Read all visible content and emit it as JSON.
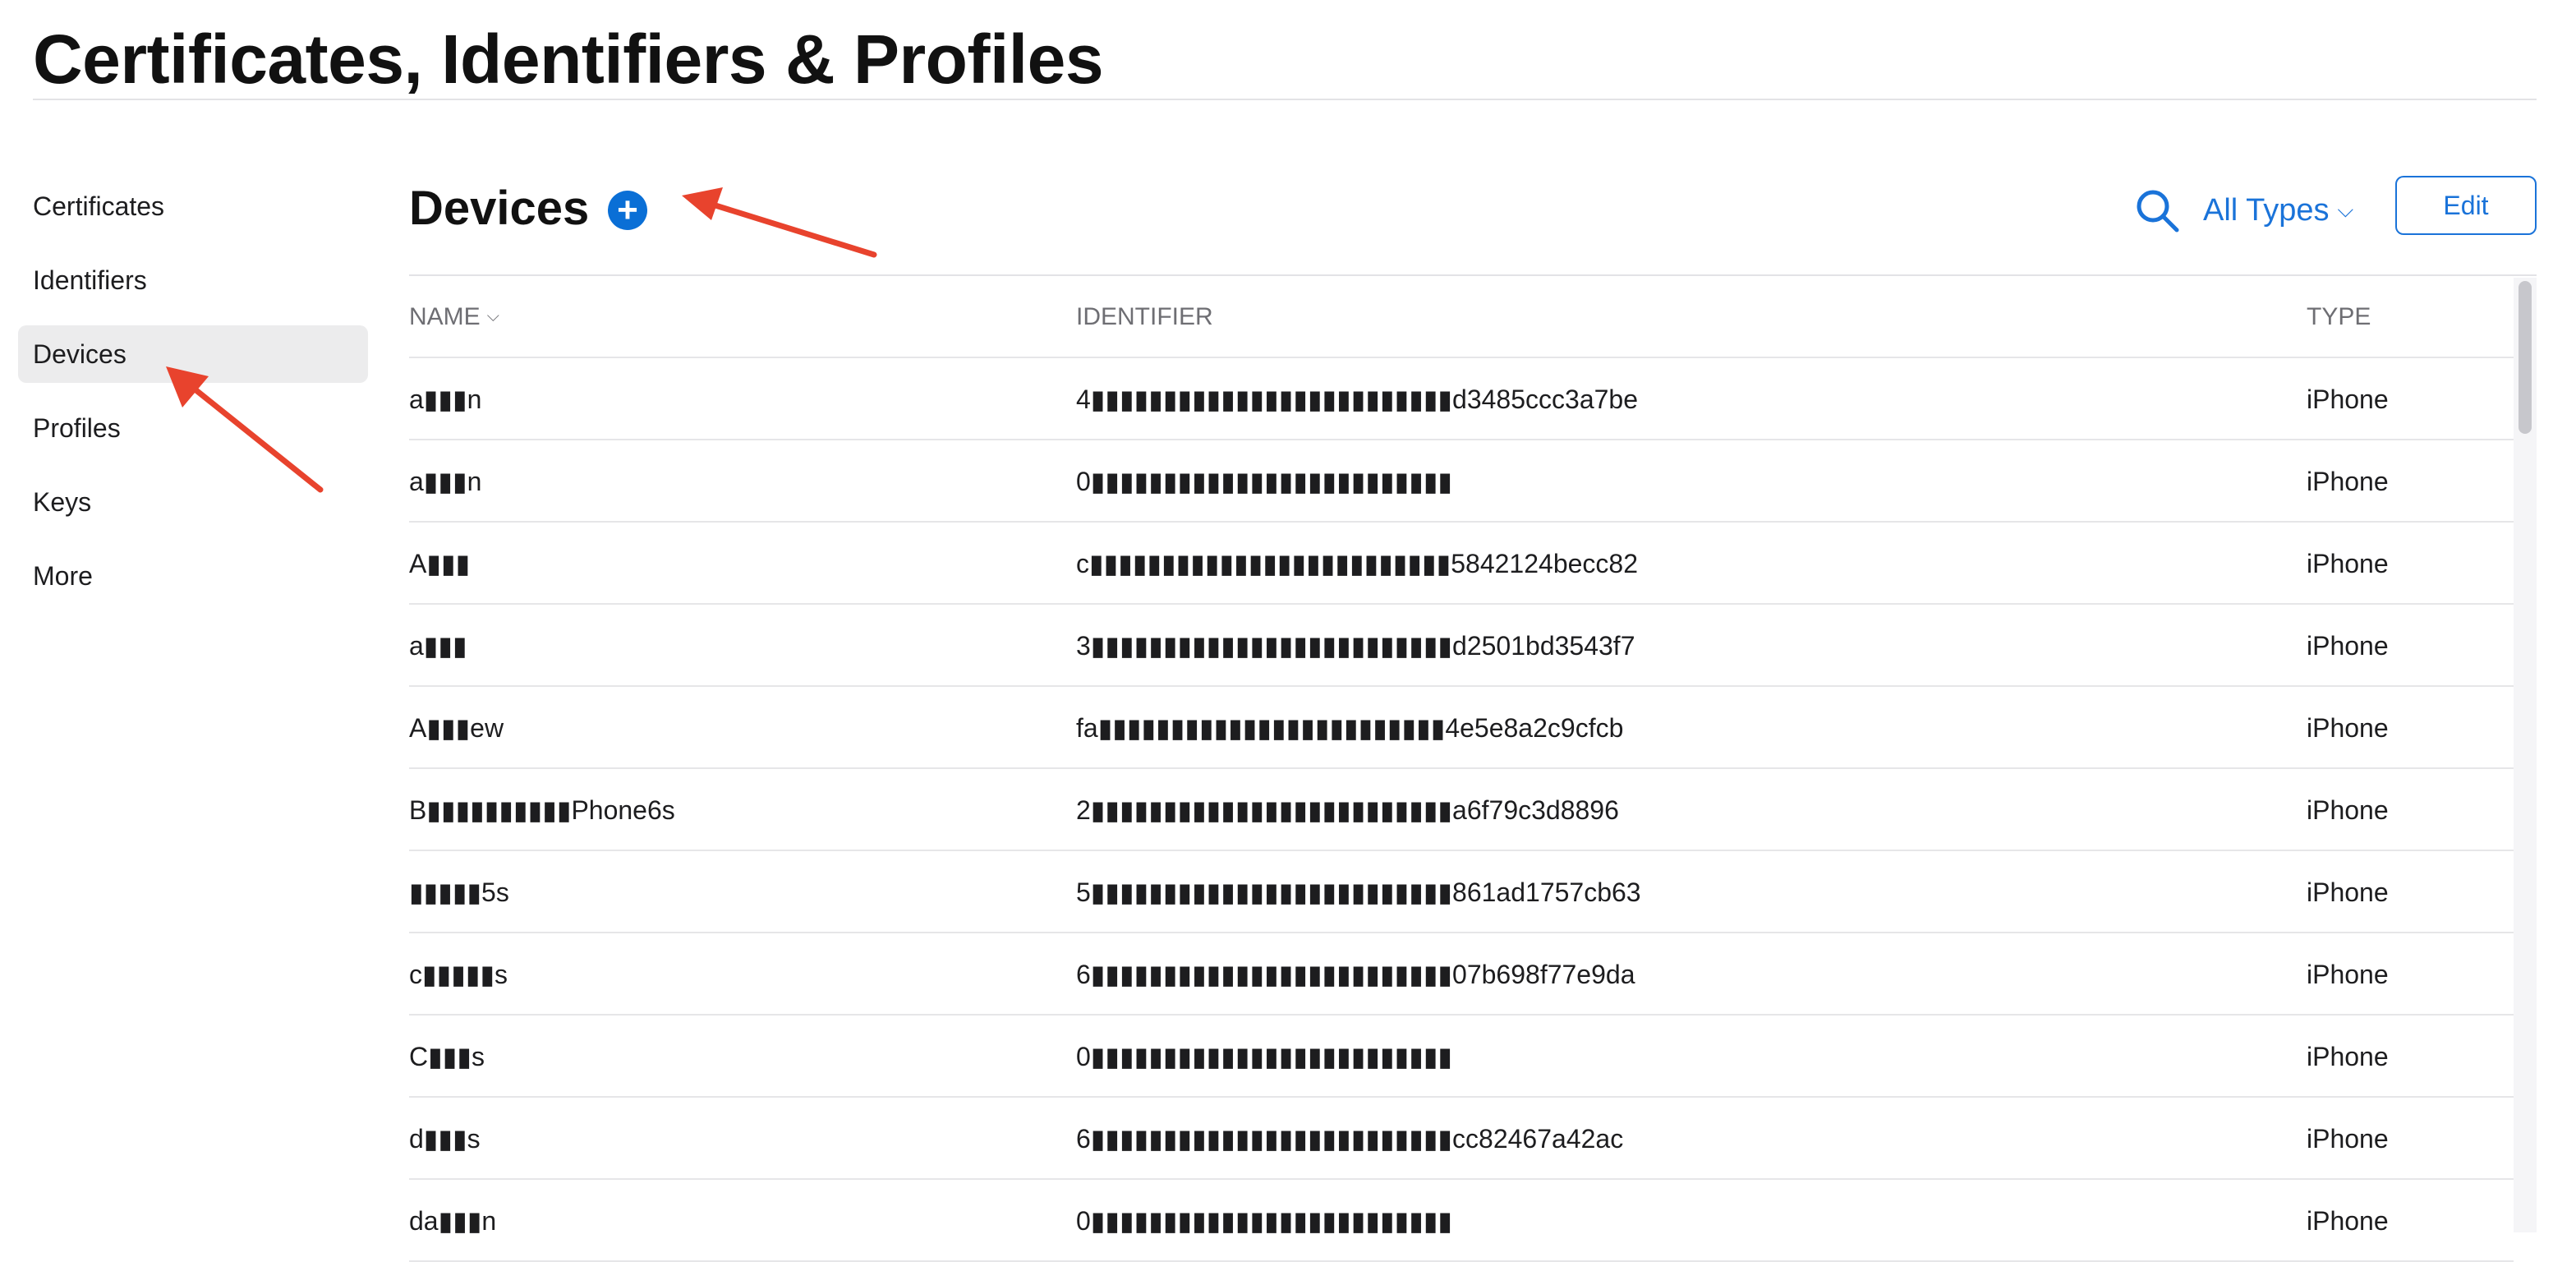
{
  "header": {
    "title": "Certificates, Identifiers & Profiles"
  },
  "sidebar": {
    "items": [
      {
        "label": "Certificates",
        "active": false
      },
      {
        "label": "Identifiers",
        "active": false
      },
      {
        "label": "Devices",
        "active": true
      },
      {
        "label": "Profiles",
        "active": false
      },
      {
        "label": "Keys",
        "active": false
      },
      {
        "label": "More",
        "active": false
      }
    ]
  },
  "main": {
    "title": "Devices",
    "add_icon": "plus-circle-icon",
    "add_glyph": "+",
    "search_icon": "search-icon",
    "filter": {
      "label": "All Types",
      "chevron": "⌵"
    },
    "edit_label": "Edit"
  },
  "table": {
    "columns": {
      "name": "NAME",
      "name_sort": "⌵",
      "identifier": "IDENTIFIER",
      "type": "TYPE"
    },
    "rows": [
      {
        "name": "a▮▮▮n",
        "identifier": "4▮▮▮▮▮▮▮▮▮▮▮▮▮▮▮▮▮▮▮▮▮▮▮▮▮d3485ccc3a7be",
        "type": "iPhone"
      },
      {
        "name": "a▮▮▮n",
        "identifier": "0▮▮▮▮▮▮▮▮▮▮▮▮▮▮▮▮▮▮▮▮▮▮▮▮▮",
        "type": "iPhone"
      },
      {
        "name": "A▮▮▮",
        "identifier": "c▮▮▮▮▮▮▮▮▮▮▮▮▮▮▮▮▮▮▮▮▮▮▮▮▮5842124becc82",
        "type": "iPhone"
      },
      {
        "name": "a▮▮▮",
        "identifier": "3▮▮▮▮▮▮▮▮▮▮▮▮▮▮▮▮▮▮▮▮▮▮▮▮▮d2501bd3543f7",
        "type": "iPhone"
      },
      {
        "name": "A▮▮▮ew",
        "identifier": "fa▮▮▮▮▮▮▮▮▮▮▮▮▮▮▮▮▮▮▮▮▮▮▮▮4e5e8a2c9cfcb",
        "type": "iPhone"
      },
      {
        "name": "B▮▮▮▮▮▮▮▮▮▮Phone6s",
        "identifier": "2▮▮▮▮▮▮▮▮▮▮▮▮▮▮▮▮▮▮▮▮▮▮▮▮▮a6f79c3d8896",
        "type": "iPhone"
      },
      {
        "name": "▮▮▮▮▮5s",
        "identifier": "5▮▮▮▮▮▮▮▮▮▮▮▮▮▮▮▮▮▮▮▮▮▮▮▮▮861ad1757cb63",
        "type": "iPhone"
      },
      {
        "name": "c▮▮▮▮▮s",
        "identifier": "6▮▮▮▮▮▮▮▮▮▮▮▮▮▮▮▮▮▮▮▮▮▮▮▮▮07b698f77e9da",
        "type": "iPhone"
      },
      {
        "name": "C▮▮▮s",
        "identifier": "0▮▮▮▮▮▮▮▮▮▮▮▮▮▮▮▮▮▮▮▮▮▮▮▮▮",
        "type": "iPhone"
      },
      {
        "name": "d▮▮▮s",
        "identifier": "6▮▮▮▮▮▮▮▮▮▮▮▮▮▮▮▮▮▮▮▮▮▮▮▮▮cc82467a42ac",
        "type": "iPhone"
      },
      {
        "name": "da▮▮▮n",
        "identifier": "0▮▮▮▮▮▮▮▮▮▮▮▮▮▮▮▮▮▮▮▮▮▮▮▮▮",
        "type": "iPhone"
      }
    ]
  },
  "colors": {
    "accent": "#1a73d9",
    "add_button": "#0a6fd6",
    "annotation_arrow": "#e8432d",
    "active_bg": "#ececed"
  },
  "annotations": [
    "annotation-arrow-add-device",
    "annotation-arrow-devices-nav"
  ]
}
